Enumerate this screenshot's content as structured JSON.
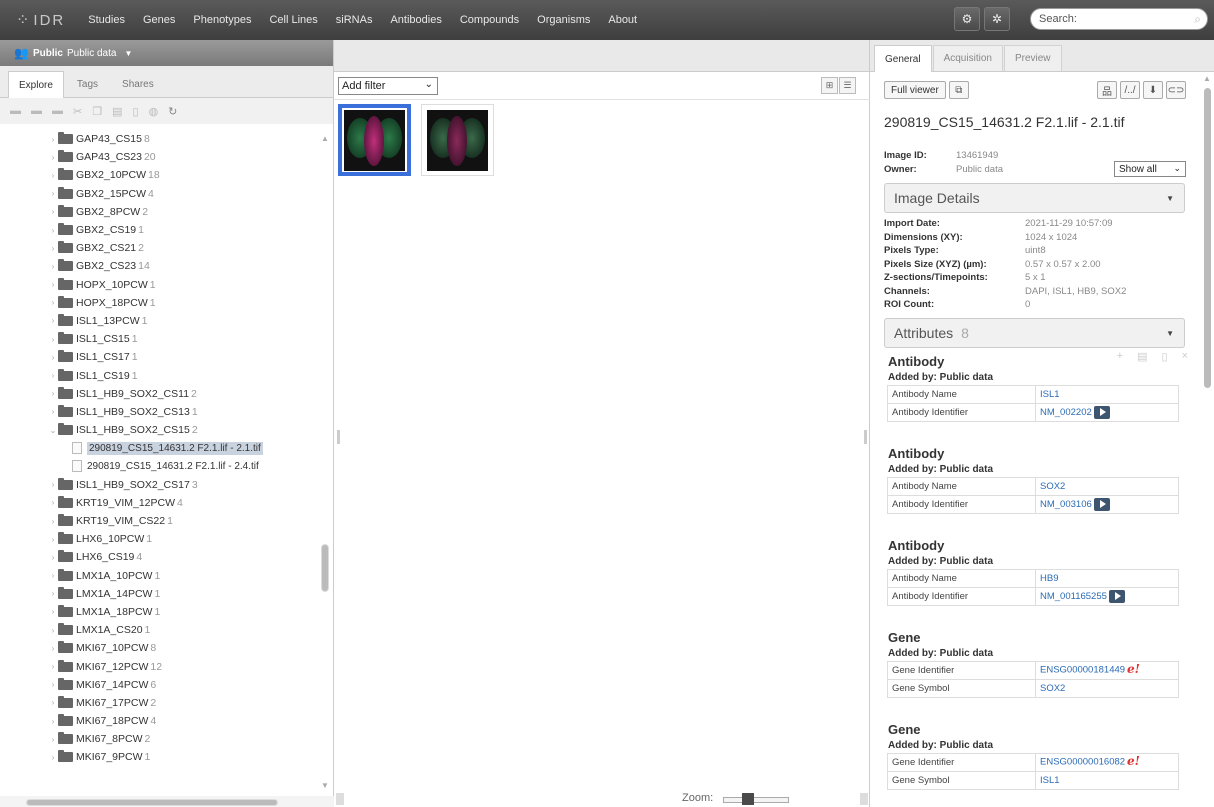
{
  "topnav": {
    "logo": "IDR",
    "links": [
      "Studies",
      "Genes",
      "Phenotypes",
      "Cell Lines",
      "siRNAs",
      "Antibodies",
      "Compounds",
      "Organisms",
      "About"
    ],
    "search_placeholder": "Search:"
  },
  "left": {
    "group_label": "Public",
    "group_name": "Public data",
    "tabs": [
      "Explore",
      "Tags",
      "Shares"
    ],
    "tree": [
      {
        "label": "GAP43_CS15",
        "count": "8"
      },
      {
        "label": "GAP43_CS23",
        "count": "20"
      },
      {
        "label": "GBX2_10PCW",
        "count": "18"
      },
      {
        "label": "GBX2_15PCW",
        "count": "4"
      },
      {
        "label": "GBX2_8PCW",
        "count": "2"
      },
      {
        "label": "GBX2_CS19",
        "count": "1"
      },
      {
        "label": "GBX2_CS21",
        "count": "2"
      },
      {
        "label": "GBX2_CS23",
        "count": "14"
      },
      {
        "label": "HOPX_10PCW",
        "count": "1"
      },
      {
        "label": "HOPX_18PCW",
        "count": "1"
      },
      {
        "label": "ISL1_13PCW",
        "count": "1"
      },
      {
        "label": "ISL1_CS15",
        "count": "1"
      },
      {
        "label": "ISL1_CS17",
        "count": "1"
      },
      {
        "label": "ISL1_CS19",
        "count": "1"
      },
      {
        "label": "ISL1_HB9_SOX2_CS11",
        "count": "2"
      },
      {
        "label": "ISL1_HB9_SOX2_CS13",
        "count": "1"
      },
      {
        "label": "ISL1_HB9_SOX2_CS15",
        "count": "2"
      },
      {
        "label": "KRT19_VIM_12PCW",
        "count": "4"
      },
      {
        "label": "KRT19_VIM_CS22",
        "count": "1"
      },
      {
        "label": "LHX6_10PCW",
        "count": "1"
      },
      {
        "label": "LHX6_CS19",
        "count": "4"
      },
      {
        "label": "LMX1A_10PCW",
        "count": "1"
      },
      {
        "label": "LMX1A_14PCW",
        "count": "1"
      },
      {
        "label": "LMX1A_18PCW",
        "count": "1"
      },
      {
        "label": "LMX1A_CS20",
        "count": "1"
      },
      {
        "label": "MKI67_10PCW",
        "count": "8"
      },
      {
        "label": "MKI67_12PCW",
        "count": "12"
      },
      {
        "label": "MKI67_14PCW",
        "count": "6"
      },
      {
        "label": "MKI67_17PCW",
        "count": "2"
      },
      {
        "label": "MKI67_18PCW",
        "count": "4"
      },
      {
        "label": "MKI67_8PCW",
        "count": "2"
      },
      {
        "label": "MKI67_9PCW",
        "count": "1"
      }
    ],
    "images": [
      "290819_CS15_14631.2 F2.1.lif - 2.1.tif",
      "290819_CS15_14631.2 F2.1.lif - 2.4.tif"
    ],
    "after_images": {
      "label": "ISL1_HB9_SOX2_CS17",
      "count": "3"
    }
  },
  "center": {
    "filter_label": "Add filter",
    "zoom_label": "Zoom:",
    "zoom_level": 0.35
  },
  "right": {
    "tabs": [
      "General",
      "Acquisition",
      "Preview"
    ],
    "full_viewer": "Full viewer",
    "image_title": "290819_CS15_14631.2 F2.1.lif - 2.1.tif",
    "image_id_label": "Image ID:",
    "image_id": "13461949",
    "owner_label": "Owner:",
    "owner": "Public data",
    "show_all": "Show all",
    "details_title": "Image Details",
    "details": [
      {
        "k": "Import Date:",
        "v": "2021-11-29 10:57:09"
      },
      {
        "k": "Dimensions (XY):",
        "v": "1024 x 1024"
      },
      {
        "k": "Pixels Type:",
        "v": "uint8"
      },
      {
        "k": "Pixels Size (XYZ) (µm):",
        "v": "0.57 x 0.57 x 2.00"
      },
      {
        "k": "Z-sections/Timepoints:",
        "v": "5 x 1"
      },
      {
        "k": "Channels:",
        "v": "DAPI, ISL1, HB9, SOX2"
      },
      {
        "k": "ROI Count:",
        "v": "0"
      }
    ],
    "attributes_title": "Attributes",
    "attributes_count": "8",
    "annotations": [
      {
        "title": "Antibody",
        "by": "Added by: Public data",
        "rows": [
          {
            "k": "Antibody Name",
            "v": "ISL1",
            "icon": ""
          },
          {
            "k": "Antibody Identifier",
            "v": "NM_002202",
            "icon": "link"
          }
        ]
      },
      {
        "title": "Antibody",
        "by": "Added by: Public data",
        "rows": [
          {
            "k": "Antibody Name",
            "v": "SOX2",
            "icon": ""
          },
          {
            "k": "Antibody Identifier",
            "v": "NM_003106",
            "icon": "link"
          }
        ]
      },
      {
        "title": "Antibody",
        "by": "Added by: Public data",
        "rows": [
          {
            "k": "Antibody Name",
            "v": "HB9",
            "icon": ""
          },
          {
            "k": "Antibody Identifier",
            "v": "NM_001165255",
            "icon": "link"
          }
        ]
      },
      {
        "title": "Gene",
        "by": "Added by: Public data",
        "rows": [
          {
            "k": "Gene Identifier",
            "v": "ENSG00000181449",
            "icon": "e"
          },
          {
            "k": "Gene Symbol",
            "v": "SOX2",
            "icon": ""
          }
        ]
      },
      {
        "title": "Gene",
        "by": "Added by: Public data",
        "rows": [
          {
            "k": "Gene Identifier",
            "v": "ENSG00000016082",
            "icon": "e"
          },
          {
            "k": "Gene Symbol",
            "v": "ISL1",
            "icon": ""
          }
        ]
      }
    ]
  }
}
